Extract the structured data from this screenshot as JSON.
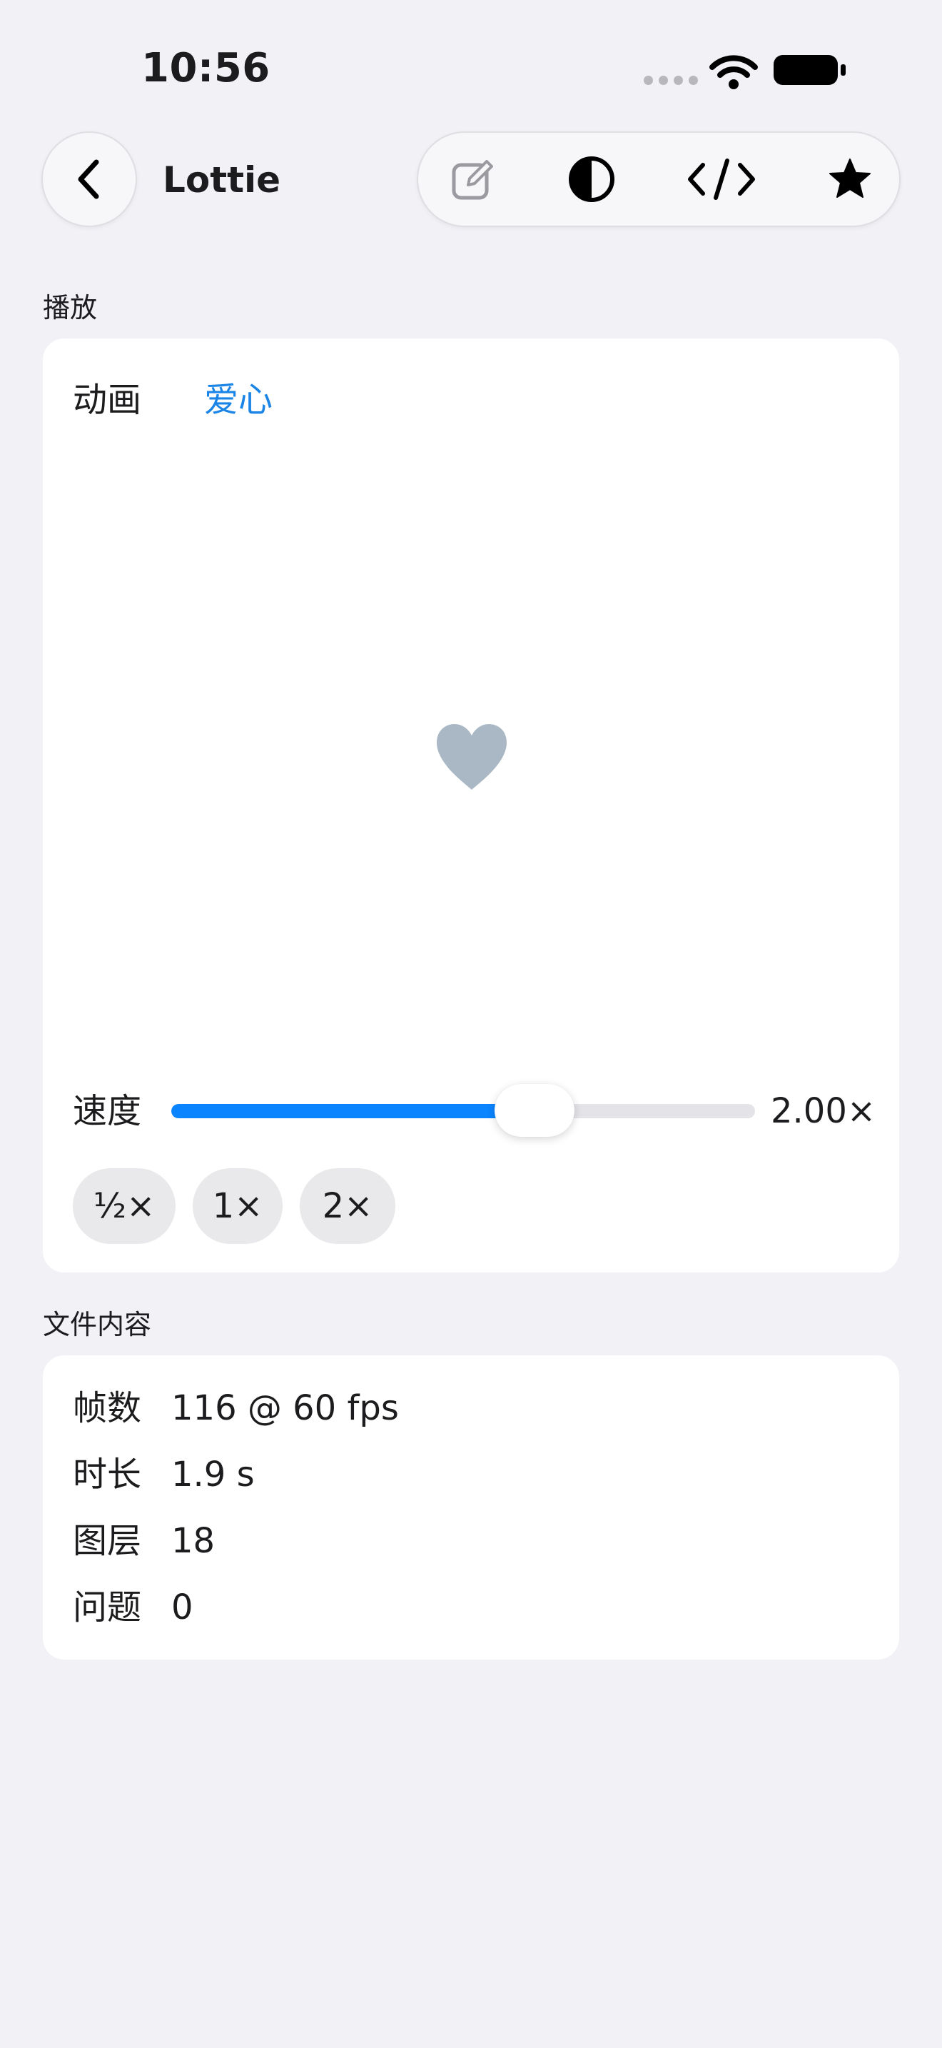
{
  "status_bar": {
    "time": "10:56"
  },
  "nav": {
    "title": "Lottie",
    "back_icon": "chevron-left-icon",
    "toolbar_icons": [
      "edit-icon",
      "contrast-icon",
      "code-icon",
      "star-icon"
    ]
  },
  "playback": {
    "section_title": "播放",
    "animation_label": "动画",
    "animation_value": "爱心",
    "speed_label": "速度",
    "speed_value": "2.00×",
    "speed_fraction": 0.622,
    "presets": [
      "½×",
      "1×",
      "2×"
    ],
    "heart_color": "#a9b8c4"
  },
  "file_content": {
    "section_title": "文件内容",
    "rows": [
      {
        "label": "帧数",
        "value": "116 @ 60 fps"
      },
      {
        "label": "时长",
        "value": "1.9 s"
      },
      {
        "label": "图层",
        "value": "18"
      },
      {
        "label": "问题",
        "value": "0"
      }
    ]
  },
  "colors": {
    "accent": "#0a84ff",
    "link": "#1a85e6",
    "background": "#f1f1f6"
  }
}
